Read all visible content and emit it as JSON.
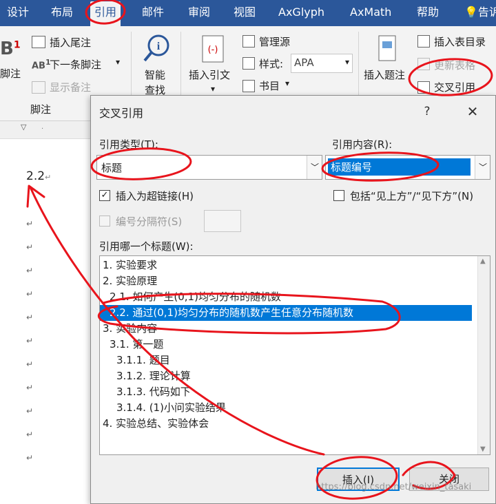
{
  "ribbon_tabs": [
    "设计",
    "布局",
    "引用",
    "邮件",
    "审阅",
    "视图",
    "AxGlyph",
    "AxMath",
    "帮助",
    "告诉"
  ],
  "ribbon": {
    "footnote_label": "脚注",
    "insert_endnote": "插入尾注",
    "next_footnote": "下一条脚注",
    "show_notes": "显示备注",
    "footnote_group": "脚注",
    "smart_lookup_1": "智能",
    "smart_lookup_2": "查找",
    "insert_citation_1": "插入引文",
    "manage_sources": "管理源",
    "style_label": "样式:",
    "style_value": "APA",
    "bibliography": "书目",
    "insert_caption": "插入题注",
    "insert_table_of_figures": "插入表目录",
    "update_table": "更新表格",
    "cross_reference": "交叉引用"
  },
  "document": {
    "first_line": "2.2"
  },
  "dialog": {
    "title": "交叉引用",
    "help": "?",
    "close": "✕",
    "ref_type_label": "引用类型(T):",
    "ref_type_value": "标题",
    "ref_content_label": "引用内容(R):",
    "ref_content_value": "标题编号",
    "insert_hyperlink": "插入为超链接(H)",
    "include_above_below": "包括“见上方”/“见下方”(N)",
    "separate_numbers": "编号分隔符(S)",
    "for_which_label": "引用哪一个标题(W):",
    "headings": [
      "1. 实验要求",
      "2. 实验原理",
      "2.1. 如何产生(0,1)均匀分布的随机数",
      "2.2. 通过(0,1)均匀分布的随机数产生任意分布随机数",
      "3. 实验内容",
      "3.1. 第一题",
      "3.1.1. 题目",
      "3.1.2. 理论计算",
      "3.1.3. 代码如下",
      "3.1.4. (1)小问实验结果",
      "4. 实验总结、实验体会"
    ],
    "insert_button": "插入(I)",
    "close_button": "关闭"
  },
  "watermark": "https://blog.csdn.net/weixin_tasaki",
  "colors": {
    "ribbon": "#2b579a",
    "selection": "#0078d7",
    "annotation": "#e8141c"
  }
}
